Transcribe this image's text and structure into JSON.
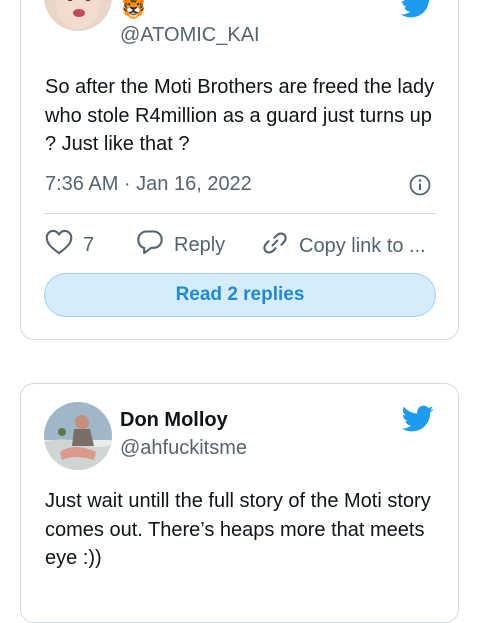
{
  "tweet1": {
    "handle": "@ATOMIC_KAI",
    "emoji": "🐯",
    "text": "So after the Moti Brothers are freed the lady who stole R4million as a guard just turns up ? Just like that ?",
    "timestamp": "7:36 AM · Jan 16, 2022",
    "like_count": "7",
    "reply_label": "Reply",
    "copy_link_label": "Copy link to ...",
    "read_replies_label": "Read 2 replies"
  },
  "tweet2": {
    "name": "Don Molloy",
    "handle": "@ahfuckitsme",
    "text": "Just wait untill the full story of the Moti story comes out. There’s heaps more that meets eye :))"
  },
  "colors": {
    "twitter_blue": "#1d9bf0",
    "border": "#cfd9de",
    "secondary_text": "#536471",
    "button_bg": "#d6ecfb"
  },
  "icons": [
    "twitter-bird-icon",
    "heart-icon",
    "reply-bubble-icon",
    "link-icon",
    "info-icon"
  ]
}
